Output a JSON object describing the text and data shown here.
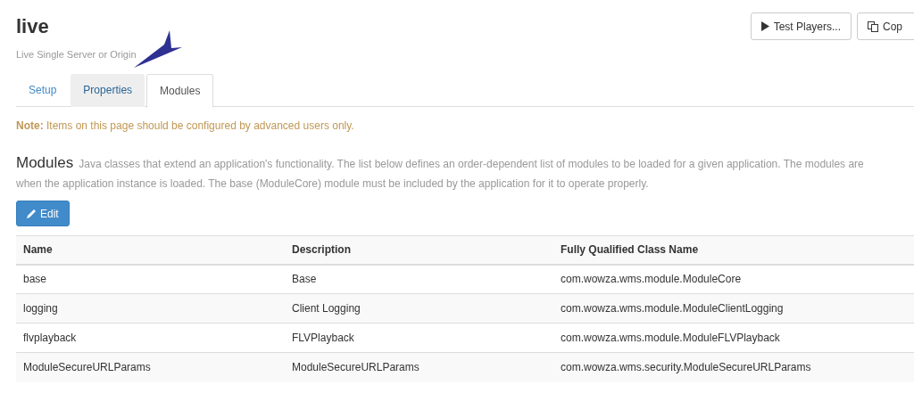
{
  "header": {
    "title": "live",
    "subtitle": "Live Single Server or Origin"
  },
  "actions": [
    {
      "kind": "play",
      "label": "Test Players..."
    },
    {
      "kind": "copy",
      "label": "Cop"
    }
  ],
  "tabs": [
    {
      "label": "Setup",
      "selected": false,
      "highlighted": false
    },
    {
      "label": "Properties",
      "selected": false,
      "highlighted": true
    },
    {
      "label": "Modules",
      "selected": true,
      "highlighted": false
    }
  ],
  "note": {
    "label": "Note:",
    "text": "Items on this page should be configured by advanced users only."
  },
  "section": {
    "heading": "Modules",
    "description_lines": [
      "Java classes that extend an application's functionality. The list below defines an order-dependent list of modules to be loaded for a given application. The modules are",
      "when the application instance is loaded. The base (ModuleCore) module must be included by the application for it to operate properly."
    ]
  },
  "edit_button": "Edit",
  "table": {
    "columns": [
      "Name",
      "Description",
      "Fully Qualified Class Name"
    ],
    "rows": [
      [
        "base",
        "Base",
        "com.wowza.wms.module.ModuleCore"
      ],
      [
        "logging",
        "Client Logging",
        "com.wowza.wms.module.ModuleClientLogging"
      ],
      [
        "flvplayback",
        "FLVPlayback",
        "com.wowza.wms.module.ModuleFLVPlayback"
      ],
      [
        "ModuleSecureURLParams",
        "ModuleSecureURLParams",
        "com.wowza.wms.security.ModuleSecureURLParams"
      ]
    ]
  }
}
